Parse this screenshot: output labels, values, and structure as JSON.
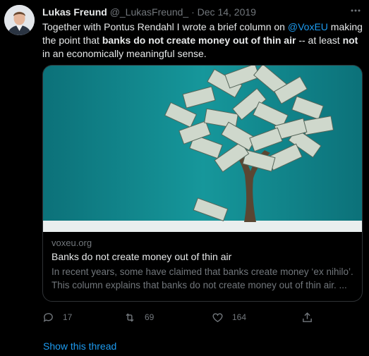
{
  "tweet": {
    "author_name": "Lukas Freund",
    "author_handle": "@_LukasFreund_",
    "separator": "·",
    "date": "Dec 14, 2019",
    "text_parts": {
      "p1": "Together with Pontus Rendahl I wrote a brief column on ",
      "mention": "@VoxEU",
      "p2": " making the point that ",
      "bold1": "banks do not create money out of thin air",
      "p3": " -- at least ",
      "bold2": "not",
      "p4": " in an economically meaningful sense."
    }
  },
  "card": {
    "domain": "voxeu.org",
    "title": "Banks do not create money out of thin air",
    "description": "In recent years, some have claimed that banks create money ‘ex nihilo’. This column explains that banks do not create money out of thin air. ..."
  },
  "actions": {
    "reply_count": "17",
    "retweet_count": "69",
    "like_count": "164"
  },
  "show_thread": "Show this thread",
  "icons": {
    "more": "more-horizontal-icon",
    "reply": "reply-icon",
    "retweet": "retweet-icon",
    "like": "heart-icon",
    "share": "share-icon"
  },
  "colors": {
    "background": "#000000",
    "text": "#e7e9ea",
    "secondary": "#71767b",
    "accent": "#1d9bf0",
    "card_border": "#2f3336"
  }
}
